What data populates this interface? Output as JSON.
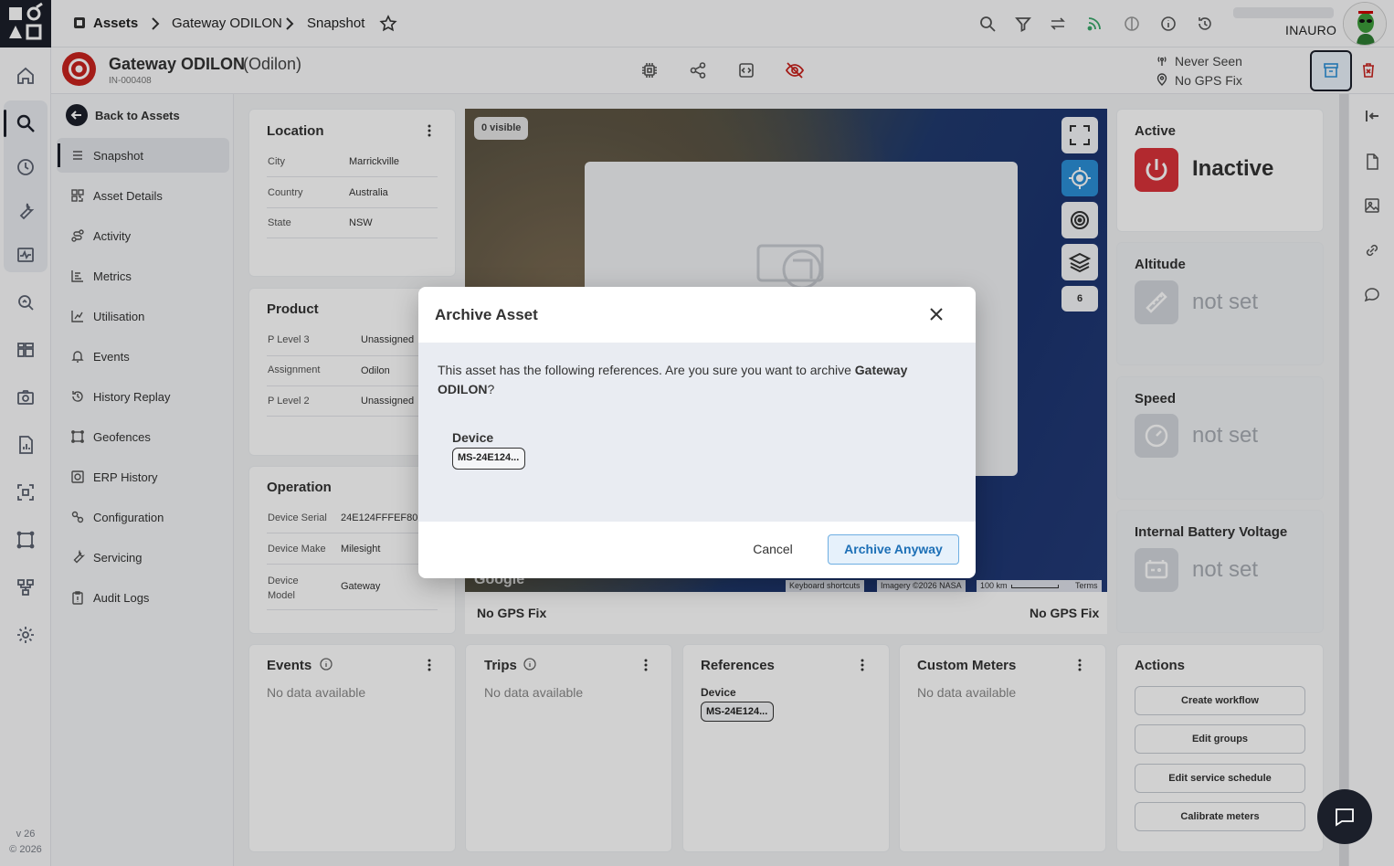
{
  "app": {
    "version": "v 26",
    "copyright": "© 2026"
  },
  "breadcrumb": {
    "root": "Assets",
    "asset": "Gateway ODILON",
    "page": "Snapshot"
  },
  "user": {
    "name": "INAURO"
  },
  "asset": {
    "name": "Gateway ODILON",
    "alias": "(Odilon)",
    "id": "IN-000408",
    "last_seen": "Never Seen",
    "gps": "No GPS Fix"
  },
  "sidebar": {
    "back": "Back to Assets",
    "items": [
      {
        "label": "Snapshot"
      },
      {
        "label": "Asset Details"
      },
      {
        "label": "Activity"
      },
      {
        "label": "Metrics"
      },
      {
        "label": "Utilisation"
      },
      {
        "label": "Events"
      },
      {
        "label": "History Replay"
      },
      {
        "label": "Geofences"
      },
      {
        "label": "ERP History"
      },
      {
        "label": "Configuration"
      },
      {
        "label": "Servicing"
      },
      {
        "label": "Audit Logs"
      }
    ]
  },
  "location": {
    "title": "Location",
    "rows": [
      {
        "k": "City",
        "v": "Marrickville"
      },
      {
        "k": "Country",
        "v": "Australia"
      },
      {
        "k": "State",
        "v": "NSW"
      }
    ]
  },
  "product": {
    "title": "Product",
    "rows": [
      {
        "k": "P Level 3",
        "v": "Unassigned"
      },
      {
        "k": "Assignment",
        "v": "Odilon"
      },
      {
        "k": "P Level 2",
        "v": "Unassigned"
      }
    ]
  },
  "operation": {
    "title": "Operation",
    "rows": [
      {
        "k": "Device Serial",
        "v": "24E124FFFEF80"
      },
      {
        "k": "Device Make",
        "v": "Milesight"
      },
      {
        "k": "Device Model",
        "v": "Gateway"
      }
    ]
  },
  "map": {
    "visible": "0 visible",
    "count": "6",
    "gps_left": "No GPS Fix",
    "gps_right": "No GPS Fix",
    "google": "Google",
    "shortcuts": "Keyboard shortcuts",
    "imagery": "Imagery ©2026 NASA",
    "scale": "100 km",
    "terms": "Terms"
  },
  "status_cards": {
    "active": {
      "title": "Active",
      "value": "Inactive"
    },
    "altitude": {
      "title": "Altitude",
      "value": "not set"
    },
    "speed": {
      "title": "Speed",
      "value": "not set"
    },
    "battery": {
      "title": "Internal Battery Voltage",
      "value": "not set"
    }
  },
  "bottom": {
    "events": {
      "title": "Events",
      "empty": "No data available"
    },
    "trips": {
      "title": "Trips",
      "empty": "No data available"
    },
    "references": {
      "title": "References",
      "sub": "Device",
      "chip": "MS-24E124..."
    },
    "meters": {
      "title": "Custom Meters",
      "empty": "No data available"
    },
    "actions": {
      "title": "Actions",
      "buttons": [
        "Create workflow",
        "Edit groups",
        "Edit service schedule",
        "Calibrate meters"
      ]
    }
  },
  "modal": {
    "title": "Archive Asset",
    "msg_prefix": "This asset has the following references. Are you sure you want to archive ",
    "msg_asset": "Gateway ODILON",
    "msg_suffix": "?",
    "ref_label": "Device",
    "ref_chip": "MS-24E124...",
    "cancel": "Cancel",
    "confirm": "Archive Anyway"
  },
  "colors": {
    "accent": "#2b8fd7",
    "danger": "#c8231e",
    "dark": "#1b1f2a"
  }
}
